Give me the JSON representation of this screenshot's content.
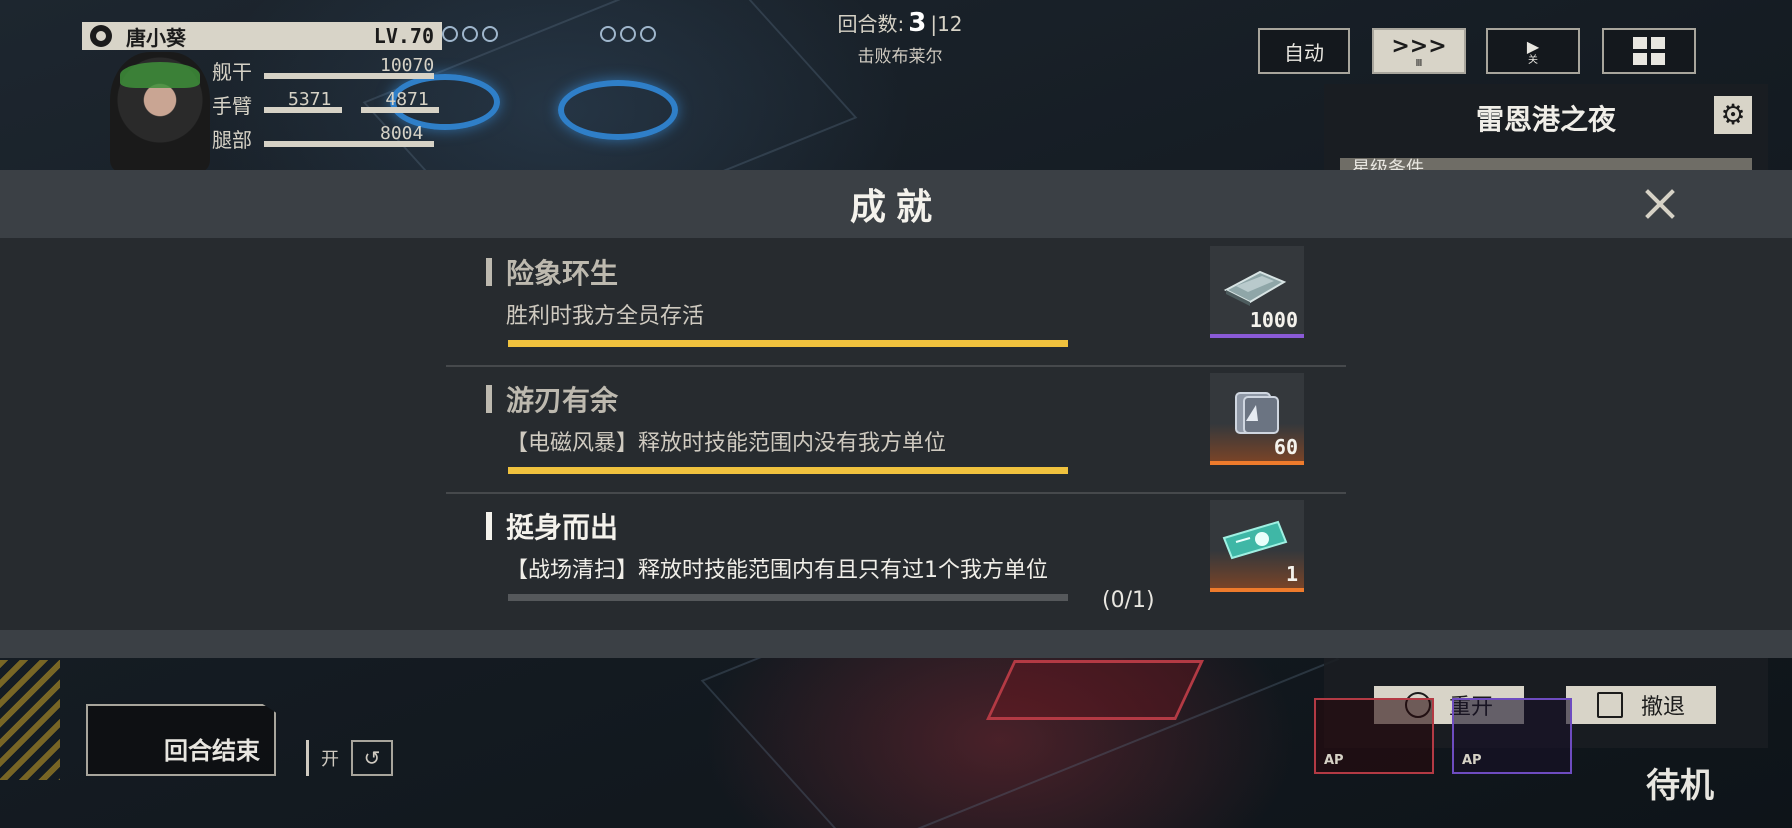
{
  "character": {
    "name": "唐小葵",
    "level": "LV.70",
    "stats": [
      {
        "label": "舰干",
        "value": "10070"
      },
      {
        "label": "手臂",
        "value": "5371",
        "value2": "4871"
      },
      {
        "label": "腿部",
        "value": "8004"
      }
    ]
  },
  "round": {
    "label": "回合数:",
    "current": "3",
    "total": "12",
    "objective": "击败布莱尔"
  },
  "top_buttons": {
    "auto": "自动",
    "speed_sub": "Ⅲ",
    "skip_sub": "关"
  },
  "side_panel": {
    "title": "雷恩港之夜",
    "section_label": "星级条件",
    "restart": "重开",
    "retreat": "撤退"
  },
  "end_turn": "回合结束",
  "toggle_label": "开",
  "standby": "待机",
  "ap_label": "AP",
  "modal": {
    "title": "成就",
    "achievements": [
      {
        "name": "险象环生",
        "description": "胜利时我方全员存活",
        "progress": 1.0,
        "status": "completed",
        "reward_qty": "1000",
        "reward_rarity": "purple",
        "reward_icon": "alloy-plate-icon"
      },
      {
        "name": "游刃有余",
        "description": "【电磁风暴】释放时技能范围内没有我方单位",
        "progress": 1.0,
        "status": "completed",
        "reward_qty": "60",
        "reward_rarity": "orange",
        "reward_icon": "metal-block-icon"
      },
      {
        "name": "挺身而出",
        "description": "【战场清扫】释放时技能范围内有且只有过1个我方单位",
        "progress": 0.0,
        "status": "pending",
        "counter": "(0/1)",
        "reward_qty": "1",
        "reward_rarity": "orange",
        "reward_icon": "ticket-icon"
      }
    ]
  },
  "colors": {
    "progress_fill": "#f0c23e",
    "rarity_purple": "#8a5ad6",
    "rarity_orange": "#ee7b2c"
  }
}
